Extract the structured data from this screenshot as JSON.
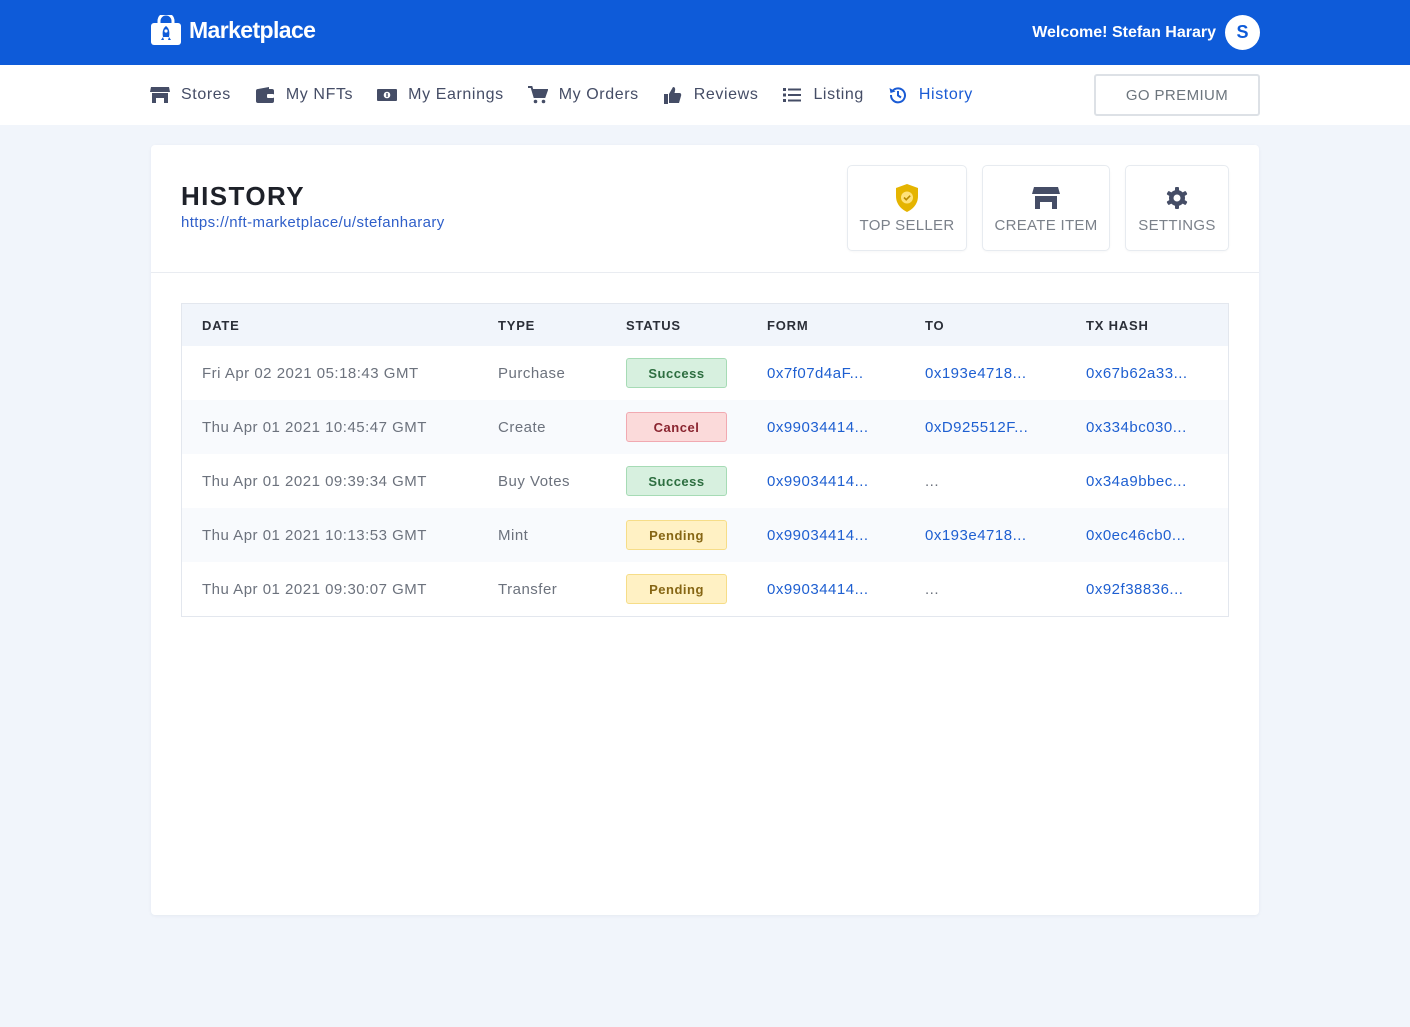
{
  "brand": {
    "name": "Marketplace"
  },
  "header": {
    "welcome": "Welcome! Stefan Harary",
    "avatar_initial": "S"
  },
  "nav": {
    "items": [
      {
        "label": "Stores",
        "icon": "store-icon"
      },
      {
        "label": "My NFTs",
        "icon": "wallet-icon"
      },
      {
        "label": "My Earnings",
        "icon": "money-bill-icon"
      },
      {
        "label": "My Orders",
        "icon": "cart-icon"
      },
      {
        "label": "Reviews",
        "icon": "thumbs-up-icon"
      },
      {
        "label": "Listing",
        "icon": "list-icon"
      },
      {
        "label": "History",
        "icon": "history-icon"
      }
    ],
    "active": "History",
    "premium_label": "GO PREMIUM"
  },
  "page": {
    "title": "HISTORY",
    "url": "https://nft-marketplace/u/stefanharary",
    "actions": [
      {
        "label": "TOP SELLER",
        "icon": "shield-check-icon"
      },
      {
        "label": "CREATE ITEM",
        "icon": "store-icon"
      },
      {
        "label": "SETTINGS",
        "icon": "gear-icon"
      }
    ]
  },
  "table": {
    "columns": [
      "DATE",
      "TYPE",
      "STATUS",
      "FORM",
      "TO",
      "TX HASH"
    ],
    "rows": [
      {
        "date": "Fri Apr 02 2021 05:18:43 GMT",
        "type": "Purchase",
        "status": "Success",
        "form": "0x7f07d4aF...",
        "to": "0x193e4718...",
        "tx": "0x67b62a33..."
      },
      {
        "date": "Thu Apr 01 2021 10:45:47 GMT",
        "type": "Create",
        "status": "Cancel",
        "form": "0x99034414...",
        "to": "0xD925512F...",
        "tx": "0x334bc030..."
      },
      {
        "date": "Thu Apr 01 2021 09:39:34 GMT",
        "type": "Buy Votes",
        "status": "Success",
        "form": "0x99034414...",
        "to": "...",
        "tx": "0x34a9bbec..."
      },
      {
        "date": "Thu Apr 01 2021 10:13:53 GMT",
        "type": "Mint",
        "status": "Pending",
        "form": "0x99034414...",
        "to": "0x193e4718...",
        "tx": "0x0ec46cb0..."
      },
      {
        "date": "Thu Apr 01 2021 09:30:07 GMT",
        "type": "Transfer",
        "status": "Pending",
        "form": "0x99034414...",
        "to": "...",
        "tx": "0x92f38836..."
      }
    ]
  },
  "colors": {
    "primary": "#0e5bd9",
    "link": "#1e5fd1",
    "success_bg": "#d7f0df",
    "cancel_bg": "#fbdada",
    "pending_bg": "#fff1c4",
    "page_bg": "#f1f5fb"
  }
}
